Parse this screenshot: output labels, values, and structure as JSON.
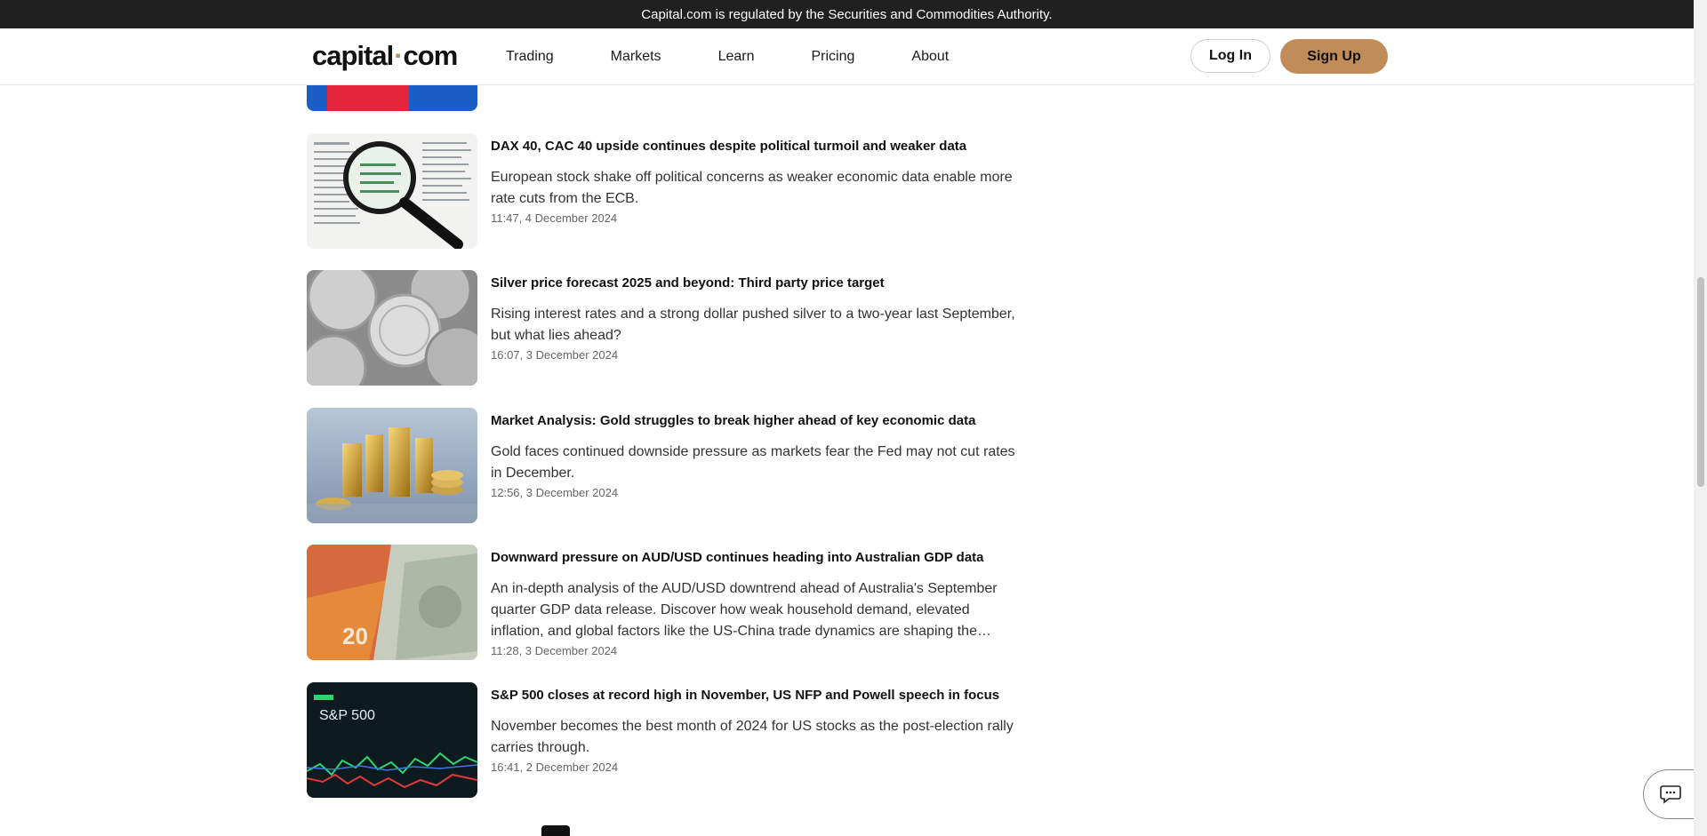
{
  "regulation_banner": "Capital.com is regulated by the Securities and Commodities Authority.",
  "header": {
    "logo_left": "capital",
    "logo_dot": "·",
    "logo_right": "com",
    "nav": [
      "Trading",
      "Markets",
      "Learn",
      "Pricing",
      "About"
    ],
    "login": "Log In",
    "signup": "Sign Up"
  },
  "colors": {
    "accent": "#c08d5a",
    "banner_bg": "#202020"
  },
  "articles": [
    {
      "title": "DAX 40, CAC 40 upside continues despite political turmoil and weaker data",
      "desc": "European stock shake off political concerns as weaker economic data enable more rate cuts from the ECB.",
      "date": "11:47, 4 December 2024",
      "image": "magnifying-glass-stock-table"
    },
    {
      "title": "Silver price forecast 2025 and beyond: Third party price target",
      "desc": "Rising interest rates and a strong dollar pushed silver to a two-year last September, but what lies ahead?",
      "date": "16:07, 3 December 2024",
      "image": "silver-coins"
    },
    {
      "title": "Market Analysis: Gold struggles to break higher ahead of key economic data",
      "desc": "Gold faces continued downside pressure as markets fear the Fed may not cut rates in December.",
      "date": "12:56, 3 December 2024",
      "image": "gold-bars-and-coins"
    },
    {
      "title": "Downward pressure on AUD/USD continues heading into Australian GDP data",
      "desc": "An in-depth analysis of the AUD/USD downtrend ahead of Australia's September quarter GDP data release. Discover how weak household demand, elevated inflation, and global factors like the US-China trade dynamics are shaping the…",
      "date": "11:28, 3 December 2024",
      "image": "aud-usd-banknotes"
    },
    {
      "title": "S&P 500 closes at record high in November, US NFP and Powell speech in focus",
      "desc": "November becomes the best month of 2024 for US stocks as the post-election rally carries through.",
      "date": "16:41, 2 December 2024",
      "image": "sp500-chart-screen",
      "image_text": "S&P 500"
    }
  ]
}
